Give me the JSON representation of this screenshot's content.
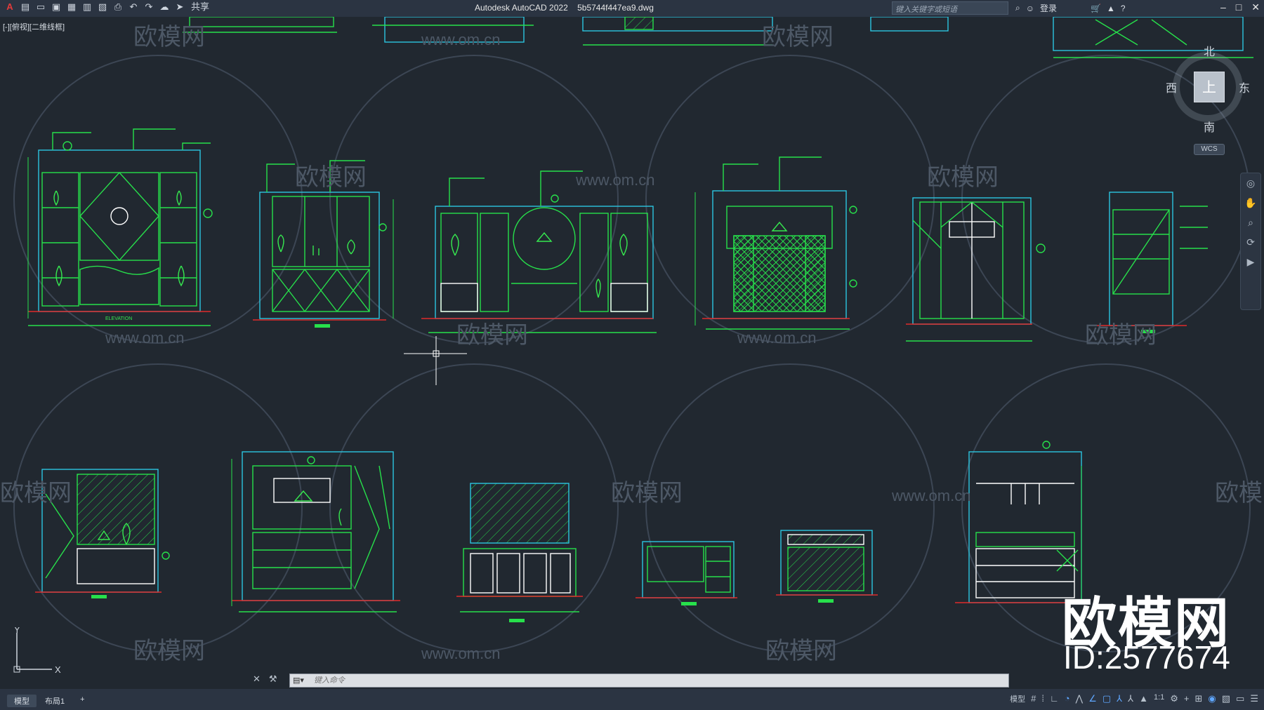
{
  "app": {
    "title": "Autodesk AutoCAD 2022",
    "filename": "5b5744f447ea9.dwg",
    "share_label": "共享",
    "search_placeholder": "键入关键字或短语",
    "login_label": "登录",
    "view_label": "[-][俯视][二维线框]"
  },
  "viewcube": {
    "north": "北",
    "south": "南",
    "west": "西",
    "east": "东",
    "top_face": "上",
    "wcs": "WCS"
  },
  "command": {
    "placeholder": "键入命令"
  },
  "status": {
    "tabs": [
      "模型",
      "布局1",
      "+"
    ],
    "model_label": "模型",
    "scale": "1:1"
  },
  "watermark": {
    "site": "www.om.cn",
    "name": "欧模网",
    "brand": "欧模网",
    "id": "ID:2577674"
  },
  "drawing": {
    "line_color": "#27e04b",
    "cabinet_color": "#2bc6e0",
    "text_color": "#36e84f",
    "elevation_label": "ELEVATION"
  },
  "ucs": {
    "x": "X",
    "y": "Y"
  }
}
